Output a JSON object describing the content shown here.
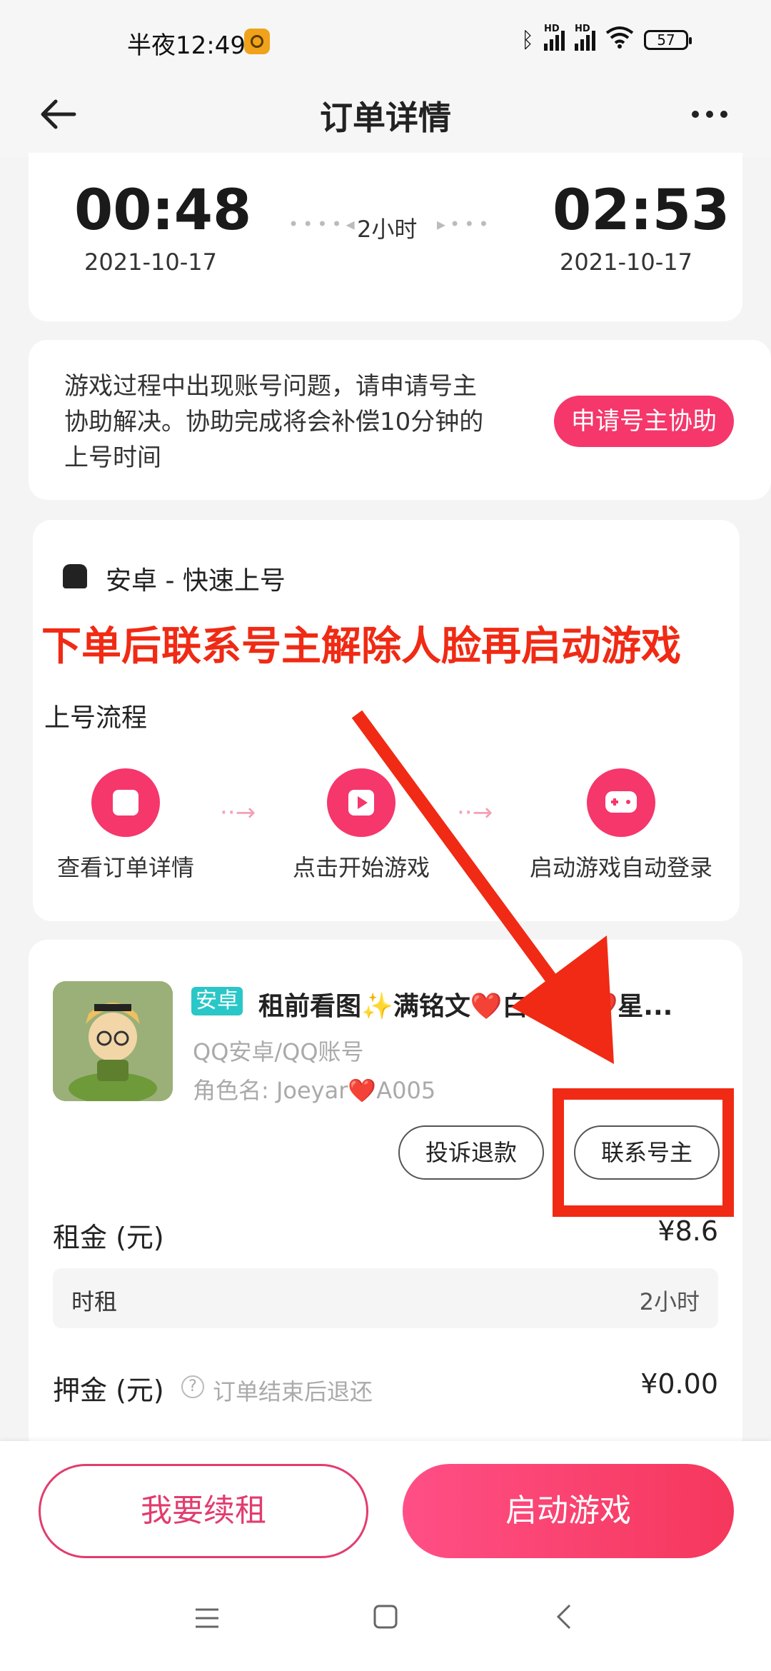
{
  "status_bar": {
    "time": "半夜12:49",
    "battery": "57",
    "hd1": "HD",
    "hd2": "HD"
  },
  "header": {
    "title": "订单详情"
  },
  "timing": {
    "start_time": "00:48",
    "start_date": "2021-10-17",
    "duration": "2小时",
    "end_time": "02:53",
    "end_date": "2021-10-17"
  },
  "notice": {
    "text": "游戏过程中出现账号问题，请申请号主协助解决。协助完成将会补偿10分钟的上号时间",
    "button": "申请号主协助"
  },
  "login": {
    "platform": "安卓 - 快速上号",
    "flow_title": "上号流程",
    "steps": [
      {
        "label": "查看订单详情"
      },
      {
        "label": "点击开始游戏"
      },
      {
        "label": "启动游戏自动登录"
      }
    ]
  },
  "overlay": {
    "text": "下单后联系号主解除人脸再启动游戏"
  },
  "product": {
    "tag": "安卓",
    "title": "租前看图✨满铭文❤️白晶➕❤️星...",
    "account_type": "QQ安卓/QQ账号",
    "role": "角色名: Joeyar❤️A005",
    "complain_button": "投诉退款",
    "contact_button": "联系号主"
  },
  "rent": {
    "label": "租金 (元)",
    "value": "¥8.6",
    "detail_label": "时租",
    "detail_value": "2小时"
  },
  "deposit": {
    "label": "押金 (元)",
    "hint": "订单结束后退还",
    "value": "¥0.00"
  },
  "actions": {
    "renew": "我要续租",
    "start": "启动游戏"
  },
  "colors": {
    "accent": "#f5376b",
    "annotation": "#f02a14",
    "tag": "#29c7c7"
  }
}
